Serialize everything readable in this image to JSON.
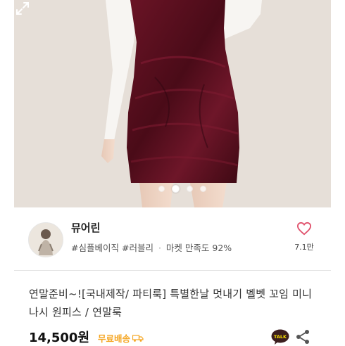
{
  "carousel": {
    "total": 4,
    "active_index": 1
  },
  "shop": {
    "name": "뮤어린",
    "tag1": "#심플베이직",
    "tag2": "#러블리",
    "satisfaction_label": "마켓 만족도",
    "satisfaction_value": "92%",
    "likes": "7.1만"
  },
  "product": {
    "title": "연말준비~![국내제작/ 파티룩] 특별한날 멋내기 벨벳 꼬임 미니 나시 원피스 / 연말룩",
    "price": "14,500원",
    "shipping": "무료배송",
    "talk_label": "TALK"
  },
  "colors": {
    "dress": "#5a0f1e",
    "accent": "#f5a623",
    "heart": "#e0506b"
  },
  "icons": [
    "expand-icon",
    "heart-icon",
    "truck-icon",
    "kakao-talk-icon",
    "share-icon"
  ]
}
